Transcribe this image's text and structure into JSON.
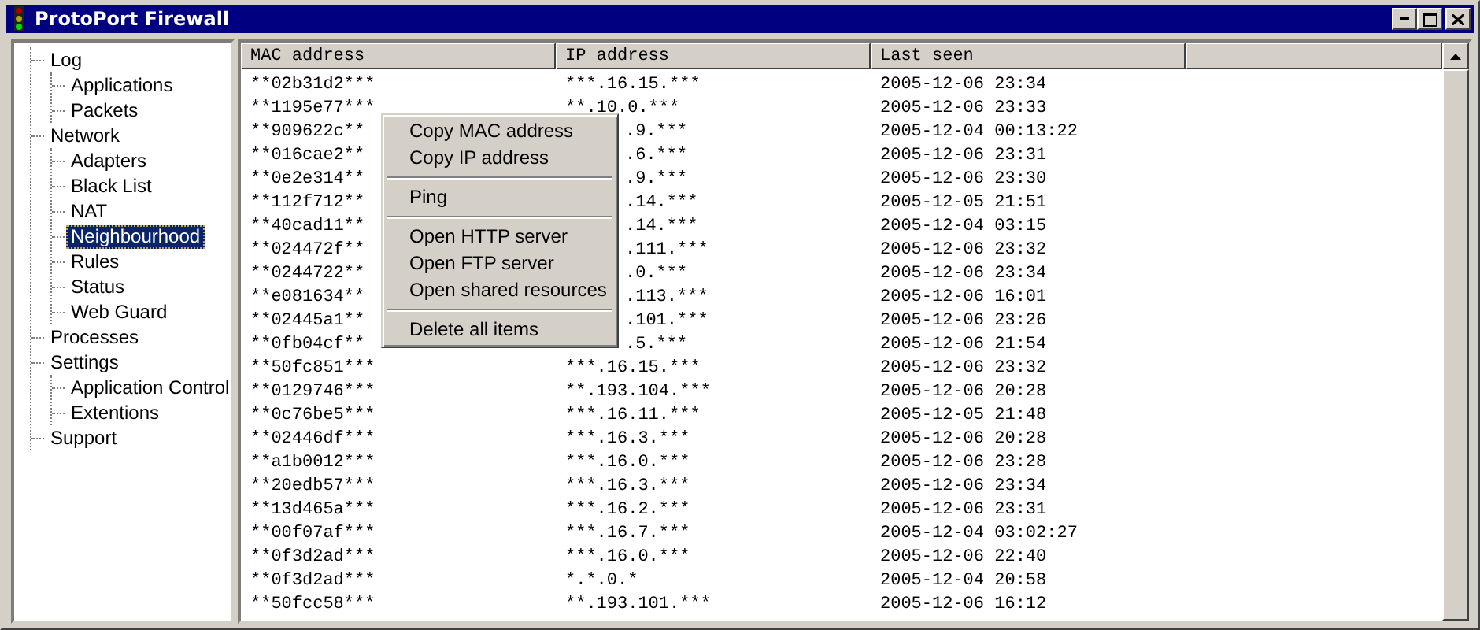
{
  "window": {
    "title": "ProtoPort Firewall"
  },
  "tree": [
    {
      "label": "Log",
      "selected": false,
      "children": [
        {
          "label": "Applications",
          "selected": false
        },
        {
          "label": "Packets",
          "selected": false
        }
      ]
    },
    {
      "label": "Network",
      "selected": false,
      "children": [
        {
          "label": "Adapters",
          "selected": false
        },
        {
          "label": "Black List",
          "selected": false
        },
        {
          "label": "NAT",
          "selected": false
        },
        {
          "label": "Neighbourhood",
          "selected": true
        },
        {
          "label": "Rules",
          "selected": false
        },
        {
          "label": "Status",
          "selected": false
        },
        {
          "label": "Web Guard",
          "selected": false
        }
      ]
    },
    {
      "label": "Processes",
      "selected": false
    },
    {
      "label": "Settings",
      "selected": false,
      "children": [
        {
          "label": "Application Control",
          "selected": false
        },
        {
          "label": "Extentions",
          "selected": false
        }
      ]
    },
    {
      "label": "Support",
      "selected": false
    }
  ],
  "table": {
    "columns": [
      "MAC address",
      "IP address",
      "Last seen"
    ],
    "rows": [
      {
        "covered": false,
        "cells": [
          "**02b31d2***",
          "***.16.15.***",
          "2005-12-06 23:34"
        ]
      },
      {
        "covered": false,
        "cells": [
          "**1195e77***",
          "**.10.0.***",
          "2005-12-06 23:33"
        ]
      },
      {
        "covered": true,
        "cells": [
          "**909622c**",
          ".9.***",
          "2005-12-04 00:13:22"
        ]
      },
      {
        "covered": true,
        "cells": [
          "**016cae2**",
          ".6.***",
          "2005-12-06 23:31"
        ]
      },
      {
        "covered": true,
        "cells": [
          "**0e2e314**",
          ".9.***",
          "2005-12-06 23:30"
        ]
      },
      {
        "covered": true,
        "cells": [
          "**112f712**",
          ".14.***",
          "2005-12-05 21:51"
        ]
      },
      {
        "covered": true,
        "cells": [
          "**40cad11**",
          ".14.***",
          "2005-12-04 03:15"
        ]
      },
      {
        "covered": true,
        "cells": [
          "**024472f**",
          ".111.***",
          "2005-12-06 23:32"
        ]
      },
      {
        "covered": true,
        "cells": [
          "**0244722**",
          ".0.***",
          "2005-12-06 23:34"
        ]
      },
      {
        "covered": true,
        "cells": [
          "**e081634**",
          ".113.***",
          "2005-12-06 16:01"
        ]
      },
      {
        "covered": true,
        "cells": [
          "**02445a1**",
          ".101.***",
          "2005-12-06 23:26"
        ]
      },
      {
        "covered": true,
        "cells": [
          "**0fb04cf**",
          ".5.***",
          "2005-12-06 21:54"
        ]
      },
      {
        "covered": false,
        "cells": [
          "**50fc851***",
          "***.16.15.***",
          "2005-12-06 23:32"
        ]
      },
      {
        "covered": false,
        "cells": [
          "**0129746***",
          "**.193.104.***",
          "2005-12-06 20:28"
        ]
      },
      {
        "covered": false,
        "cells": [
          "**0c76be5***",
          "***.16.11.***",
          "2005-12-05 21:48"
        ]
      },
      {
        "covered": false,
        "cells": [
          "**02446df***",
          "***.16.3.***",
          "2005-12-06 20:28"
        ]
      },
      {
        "covered": false,
        "cells": [
          "**a1b0012***",
          "***.16.0.***",
          "2005-12-06 23:28"
        ]
      },
      {
        "covered": false,
        "cells": [
          "**20edb57***",
          "***.16.3.***",
          "2005-12-06 23:34"
        ]
      },
      {
        "covered": false,
        "cells": [
          "**13d465a***",
          "***.16.2.***",
          "2005-12-06 23:31"
        ]
      },
      {
        "covered": false,
        "cells": [
          "**00f07af***",
          "***.16.7.***",
          "2005-12-04 03:02:27"
        ]
      },
      {
        "covered": false,
        "cells": [
          "**0f3d2ad***",
          "***.16.0.***",
          "2005-12-06 22:40"
        ]
      },
      {
        "covered": false,
        "cells": [
          "**0f3d2ad***",
          "*.*.0.*",
          "2005-12-04 20:58"
        ]
      },
      {
        "covered": false,
        "cells": [
          "**50fcc58***",
          "**.193.101.***",
          "2005-12-06 16:12"
        ]
      }
    ]
  },
  "context_menu": {
    "groups": [
      [
        "Copy MAC address",
        "Copy IP address"
      ],
      [
        "Ping"
      ],
      [
        "Open HTTP server",
        "Open FTP server",
        "Open shared resources"
      ],
      [
        "Delete all items"
      ]
    ]
  }
}
